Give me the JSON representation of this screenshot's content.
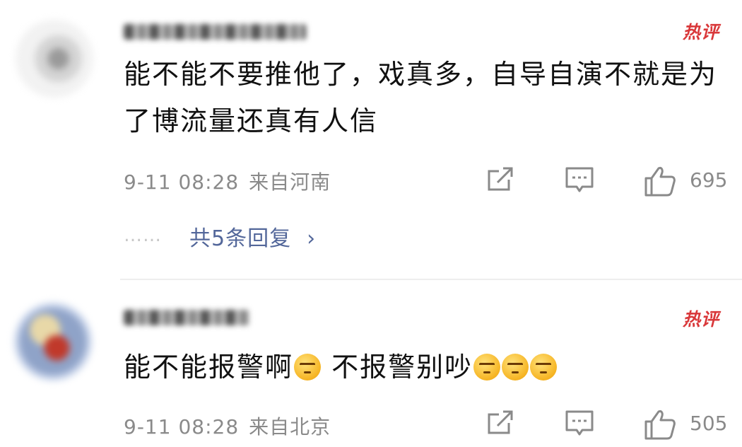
{
  "comments": [
    {
      "badge": "热评",
      "text": "能不能不要推他了，戏真多，自导自演不就是为了博流量还真有人信",
      "date": "9-11 08:28",
      "location": "来自河南",
      "likes": "695",
      "replies_label": "共5条回复",
      "dots": "……",
      "chevron": "›"
    },
    {
      "badge": "热评",
      "text_a": "能不能报警啊",
      "text_b": "不报警别吵",
      "date": "9-11 08:28",
      "location": "来自北京",
      "likes": "505"
    }
  ],
  "icons": {
    "share": "share-icon",
    "reply": "reply-icon",
    "like": "thumbs-up-icon",
    "emoji": "speechless-face-emoji"
  },
  "colors": {
    "badge": "#d9383a",
    "link": "#53679a",
    "meta": "#8a8a8a"
  }
}
